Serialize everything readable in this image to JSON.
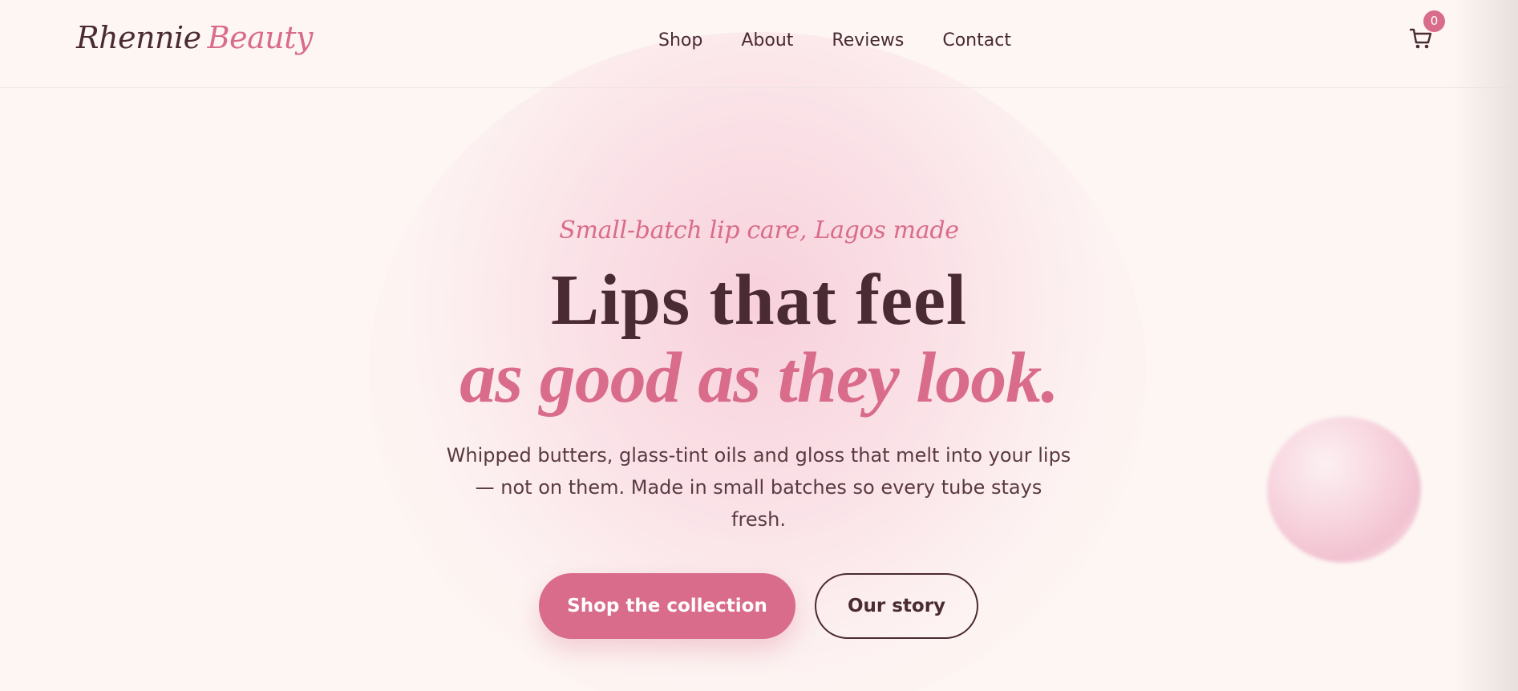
{
  "header": {
    "logo": {
      "word1": "Rhennie",
      "word2": "Beauty"
    },
    "nav": [
      {
        "label": "Shop"
      },
      {
        "label": "About"
      },
      {
        "label": "Reviews"
      },
      {
        "label": "Contact"
      }
    ],
    "cart": {
      "icon": "cart-icon",
      "count": "0"
    }
  },
  "hero": {
    "tagline": "Small-batch lip care, Lagos made",
    "headline_line1": "Lips that feel",
    "headline_line2": "as good as they look.",
    "subcopy": "Whipped butters, glass-tint oils and gloss that melt into your lips — not on them. Made in small batches so every tube stays fresh.",
    "primary_button": "Shop the collection",
    "secondary_button": "Our story"
  },
  "colors": {
    "accent": "#d96c8a",
    "text": "#4a2a33",
    "background": "#fdf6f3"
  }
}
